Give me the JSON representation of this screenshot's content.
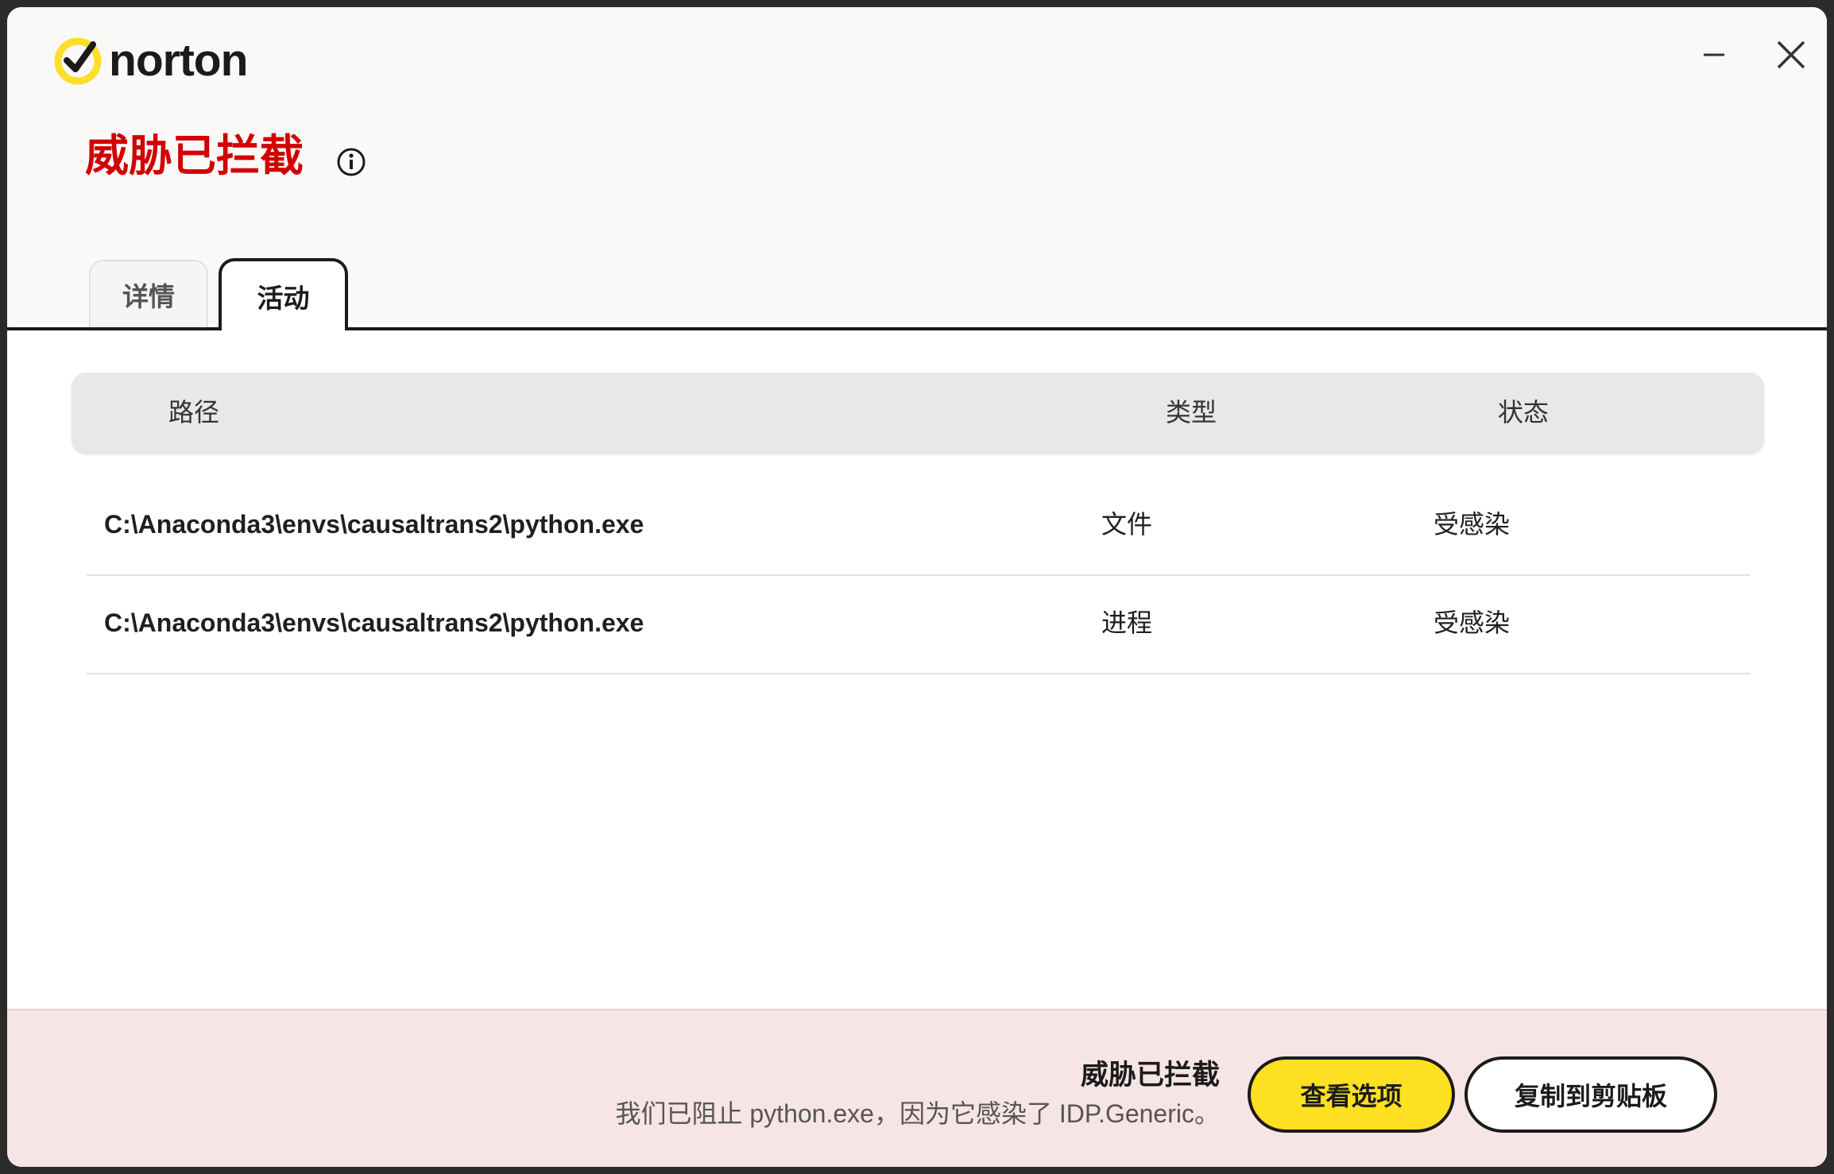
{
  "app": {
    "brand_name": "norton",
    "brand_color": "#fede2a"
  },
  "window_controls": {
    "minimize_icon": "minimize-icon",
    "close_icon": "close-icon"
  },
  "header": {
    "title": "威胁已拦截",
    "title_color": "#d20000",
    "info_icon": "info-icon"
  },
  "tabs": [
    {
      "label": "详情",
      "active": false
    },
    {
      "label": "活动",
      "active": true
    }
  ],
  "table": {
    "columns": [
      "路径",
      "类型",
      "状态"
    ],
    "rows": [
      {
        "path": "C:\\Anaconda3\\envs\\causaltrans2\\python.exe",
        "type": "文件",
        "status": "受感染"
      },
      {
        "path": "C:\\Anaconda3\\envs\\causaltrans2\\python.exe",
        "type": "进程",
        "status": "受感染"
      }
    ]
  },
  "footer": {
    "title": "威胁已拦截",
    "message": "我们已阻止 python.exe，因为它感染了 IDP.Generic。",
    "primary_button": "查看选项",
    "secondary_button": "复制到剪贴板",
    "background_color": "#f7e4e5",
    "primary_color": "#fde022"
  }
}
